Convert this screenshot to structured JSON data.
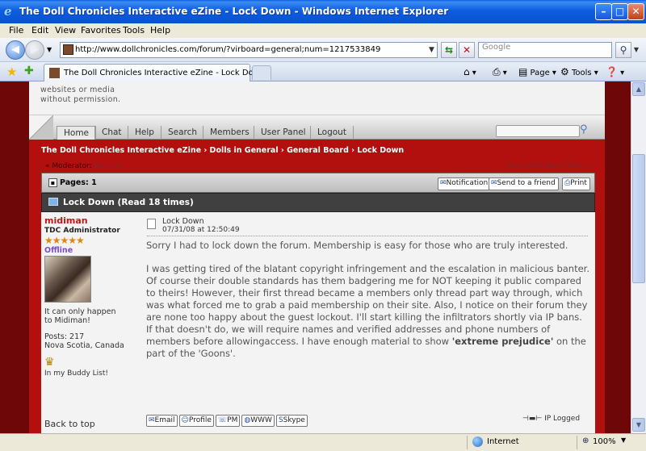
{
  "window": {
    "title": "The Doll Chronicles Interactive eZine - Lock Down - Windows Internet Explorer",
    "minimize": "–",
    "maximize": "□",
    "close": "✕"
  },
  "menu": [
    "File",
    "Edit",
    "View",
    "Favorites",
    "Tools",
    "Help"
  ],
  "address": {
    "url": "http://www.dollchronicles.com/forum/?virboard=general;num=1217533849",
    "search_placeholder": "Google"
  },
  "tab": {
    "label": "The Doll Chronicles Interactive eZine - Lock Down"
  },
  "commands": {
    "page": "Page",
    "tools": "Tools"
  },
  "site": {
    "notice_line1": "websites or media",
    "notice_line2": "without permission.",
    "nav": [
      "Home",
      "Chat",
      "Help",
      "Search",
      "Members",
      "User Panel",
      "Logout"
    ],
    "breadcrumb": "The Doll Chronicles Interactive eZine › Dolls in General › General Board › Lock Down",
    "moderator_label": "« Moderator:",
    "moderator_name": "Bunsca",
    "topic_nav_prev": "Prev topic",
    "topic_nav_next": "Next Topic »",
    "pages": "Pages: 1",
    "buttons": {
      "notification": "Notification",
      "send_friend": "Send to a friend",
      "print": "Print"
    },
    "topic_title": "Lock Down  (Read 18 times)"
  },
  "post": {
    "author": "midiman",
    "role": "TDC Administrator",
    "stars": "★★★★★",
    "status": "Offline",
    "motto_line1": "It can only happen",
    "motto_line2": "to Midiman!",
    "posts_line1": "Posts: 217",
    "posts_line2": "Nova Scotia, Canada",
    "buddy": "In my Buddy List!",
    "subject": "Lock Down",
    "date": "07/31/08 at 12:50:49",
    "para1": "Sorry I had to lock down the forum.  Membership is easy for those who are truly interested.",
    "para2a": "I was getting tired of the blatant copyright infringement and the escalation in malicious banter.  Of course their double standards has them badgering me for NOT keeping it public compared to theirs!  However,  their first thread became a members only thread part way through,  which was what forced me to grab a paid membership on their site.  Also, I notice on their forum they are none too happy about the guest lockout.  I'll start killing the infiltrators shortly via IP bans.  If that doesn't do, we will require names and verified addresses and phone numbers of members before allowingaccess.  I have enough material to show ",
    "para2b": "'extreme prejudice'",
    "para2c": "   on the part of the 'Goons'.",
    "back_to_top": "Back to top",
    "btn_email": "Email",
    "btn_profile": "Profile",
    "btn_pm": "PM",
    "btn_www": "WWW",
    "btn_skype": "Skype",
    "ip_logged": "IP Logged"
  },
  "status": {
    "zone": "Internet",
    "zoom": "100%"
  }
}
